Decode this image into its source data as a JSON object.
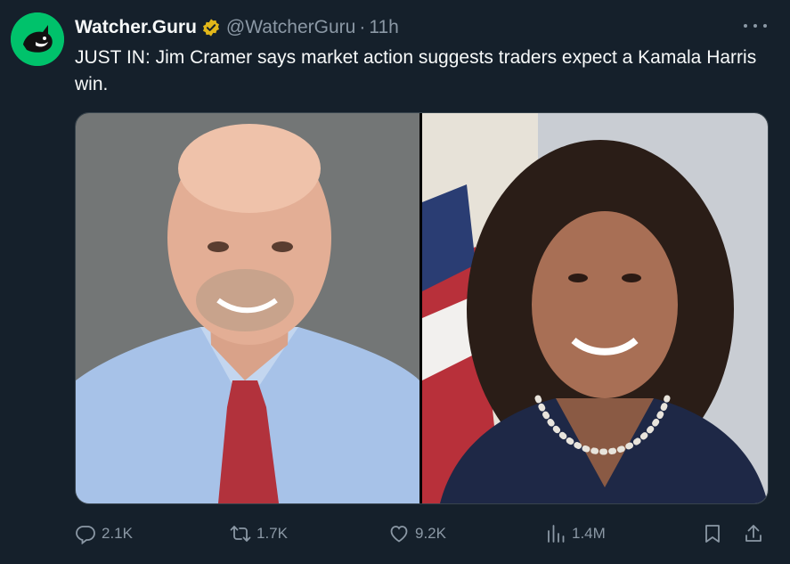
{
  "tweet": {
    "author_name": "Watcher.Guru",
    "handle": "@WatcherGuru",
    "separator": "·",
    "time": "11h",
    "text": "JUST IN: Jim Cramer says market action suggests traders expect a Kamala Harris win.",
    "media": [
      {
        "icon": "photo-jim-cramer"
      },
      {
        "icon": "photo-kamala-harris"
      }
    ]
  },
  "actions": {
    "replies": "2.1K",
    "reposts": "1.7K",
    "likes": "9.2K",
    "views": "1.4M"
  },
  "colors": {
    "background": "#15202b",
    "secondary_text": "#8b98a5",
    "brand": "#00c26b",
    "verified": "#e2b719"
  }
}
